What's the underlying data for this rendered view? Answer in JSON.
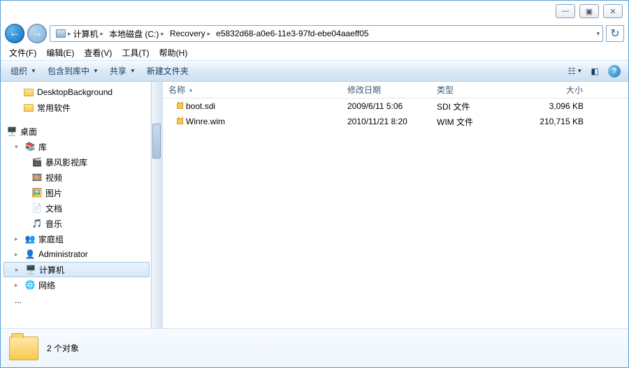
{
  "window_controls": {
    "min": "—",
    "max": "▣",
    "close": "✕"
  },
  "nav": {
    "back_icon": "←",
    "fwd_icon": "→"
  },
  "breadcrumb": [
    {
      "label": "计算机",
      "icon": "computer"
    },
    {
      "label": "本地磁盘 (C:)"
    },
    {
      "label": "Recovery"
    },
    {
      "label": "e5832d68-a0e6-11e3-97fd-ebe04aaeff05"
    }
  ],
  "menu": [
    {
      "label": "文件(F)"
    },
    {
      "label": "编辑(E)"
    },
    {
      "label": "查看(V)"
    },
    {
      "label": "工具(T)"
    },
    {
      "label": "帮助(H)"
    }
  ],
  "toolbar": {
    "organize": "组织",
    "include": "包含到库中",
    "share": "共享",
    "newfolder": "新建文件夹"
  },
  "columns": {
    "name": "名称",
    "date": "修改日期",
    "type": "类型",
    "size": "大小"
  },
  "col_widths": {
    "name": 256,
    "date": 128,
    "type": 116,
    "size": 110
  },
  "files": [
    {
      "name": "boot.sdi",
      "date": "2009/6/11 5:06",
      "type": "SDI 文件",
      "size": "3,096 KB"
    },
    {
      "name": "Winre.wim",
      "date": "2010/11/21 8:20",
      "type": "WIM 文件",
      "size": "210,715 KB"
    }
  ],
  "tree": {
    "top": [
      {
        "label": "DesktopBackground",
        "indent": 28,
        "icon": "folder"
      },
      {
        "label": "常用软件",
        "indent": 28,
        "icon": "folder"
      }
    ],
    "desktop": {
      "label": "桌面",
      "icon": "desktop",
      "expanded": true
    },
    "lib": {
      "label": "库",
      "expanded": true,
      "children": [
        {
          "label": "暴风影视库",
          "icon": "video-group"
        },
        {
          "label": "视频",
          "icon": "video"
        },
        {
          "label": "图片",
          "icon": "picture"
        },
        {
          "label": "文档",
          "icon": "document"
        },
        {
          "label": "音乐",
          "icon": "music"
        }
      ]
    },
    "homegroup": {
      "label": "家庭组",
      "icon": "homegroup"
    },
    "admin": {
      "label": "Administrator",
      "icon": "user"
    },
    "computer": {
      "label": "计算机",
      "icon": "computer",
      "selected": true
    },
    "network": {
      "label": "网络",
      "icon": "network"
    },
    "ellipsis": "..."
  },
  "status": {
    "text": "2 个对象"
  }
}
